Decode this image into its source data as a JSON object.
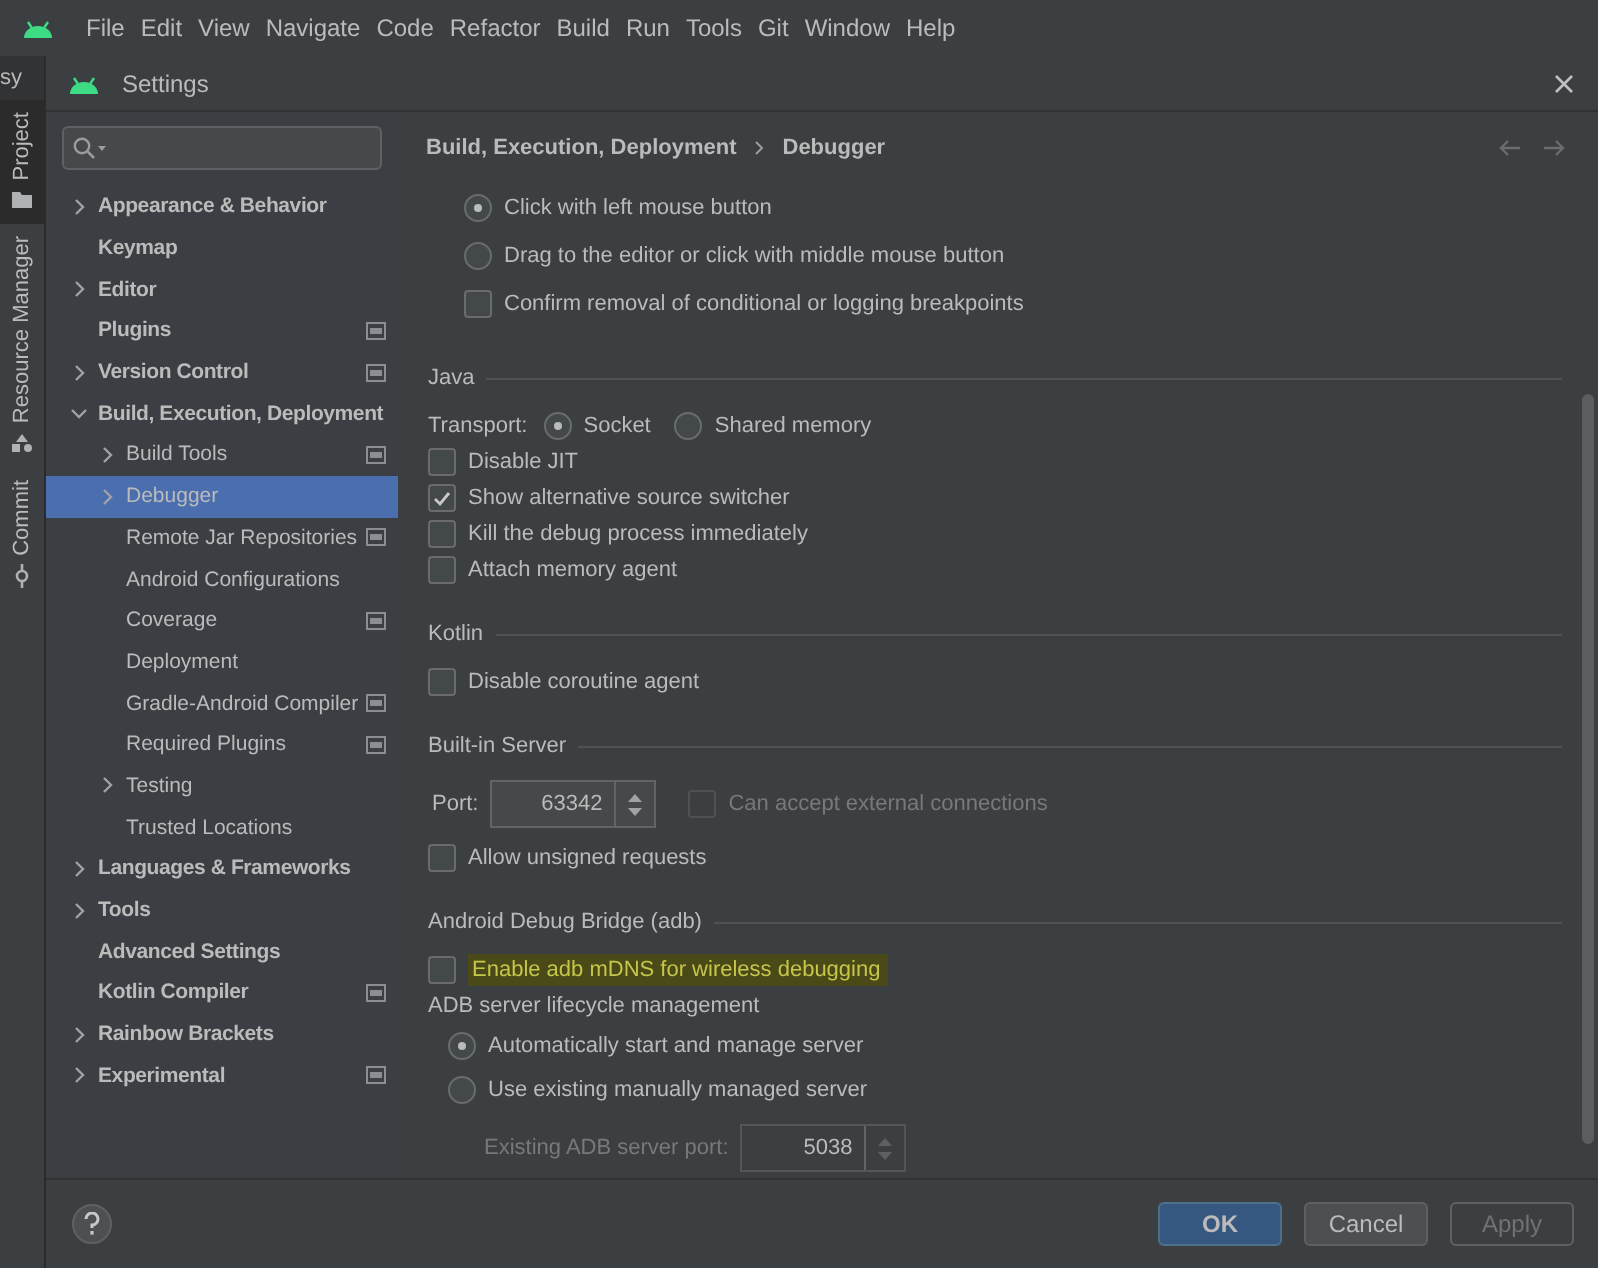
{
  "menubar": {
    "items": [
      "File",
      "Edit",
      "View",
      "Navigate",
      "Code",
      "Refactor",
      "Build",
      "Run",
      "Tools",
      "Git",
      "Window",
      "Help"
    ]
  },
  "ide_strip": {
    "project_name": "sy",
    "tabs": [
      {
        "label": "Project",
        "selected": true,
        "kind": "folder"
      },
      {
        "label": "Resource Manager",
        "selected": false,
        "kind": "shapes"
      },
      {
        "label": "Commit",
        "selected": false,
        "kind": "commit"
      }
    ]
  },
  "window": {
    "title": "Settings"
  },
  "sidebar": {
    "items": [
      {
        "label": "Appearance & Behavior",
        "kind": "branch",
        "expanded": false,
        "selected": false,
        "project_level": false
      },
      {
        "label": "Keymap",
        "kind": "leaf",
        "selected": false,
        "project_level": false
      },
      {
        "label": "Editor",
        "kind": "branch",
        "expanded": false,
        "selected": false,
        "project_level": false
      },
      {
        "label": "Plugins",
        "kind": "leaf",
        "selected": false,
        "project_level": true
      },
      {
        "label": "Version Control",
        "kind": "branch",
        "expanded": false,
        "selected": false,
        "project_level": true
      },
      {
        "label": "Build, Execution, Deployment",
        "kind": "branch",
        "expanded": true,
        "selected": false,
        "project_level": false,
        "children": [
          {
            "label": "Build Tools",
            "kind": "branch",
            "expanded": false,
            "selected": false,
            "project_level": true
          },
          {
            "label": "Debugger",
            "kind": "branch",
            "expanded": false,
            "selected": true,
            "project_level": false
          },
          {
            "label": "Remote Jar Repositories",
            "kind": "leaf",
            "selected": false,
            "project_level": true
          },
          {
            "label": "Android Configurations",
            "kind": "leaf",
            "selected": false,
            "project_level": false
          },
          {
            "label": "Coverage",
            "kind": "leaf",
            "selected": false,
            "project_level": true
          },
          {
            "label": "Deployment",
            "kind": "leaf",
            "selected": false,
            "project_level": false
          },
          {
            "label": "Gradle-Android Compiler",
            "kind": "leaf",
            "selected": false,
            "project_level": true
          },
          {
            "label": "Required Plugins",
            "kind": "leaf",
            "selected": false,
            "project_level": true
          },
          {
            "label": "Testing",
            "kind": "branch",
            "expanded": false,
            "selected": false,
            "project_level": false
          },
          {
            "label": "Trusted Locations",
            "kind": "leaf",
            "selected": false,
            "project_level": false
          }
        ]
      },
      {
        "label": "Languages & Frameworks",
        "kind": "branch",
        "expanded": false,
        "selected": false,
        "project_level": false
      },
      {
        "label": "Tools",
        "kind": "branch",
        "expanded": false,
        "selected": false,
        "project_level": false
      },
      {
        "label": "Advanced Settings",
        "kind": "leaf",
        "selected": false,
        "project_level": false
      },
      {
        "label": "Kotlin Compiler",
        "kind": "leaf",
        "selected": false,
        "project_level": true
      },
      {
        "label": "Rainbow Brackets",
        "kind": "branch",
        "expanded": false,
        "selected": false,
        "project_level": false
      },
      {
        "label": "Experimental",
        "kind": "branch",
        "expanded": false,
        "selected": false,
        "project_level": true
      }
    ]
  },
  "content": {
    "breadcrumb": [
      "Build, Execution, Deployment",
      "Debugger"
    ],
    "sections": [
      {
        "rows": [
          {
            "kind": "radio",
            "label": "Click with left mouse button",
            "selected": true
          },
          {
            "kind": "radio",
            "label": "Drag to the editor or click with middle mouse button",
            "selected": false
          },
          {
            "kind": "checkbox",
            "label": "Confirm removal of conditional or logging breakpoints",
            "checked": false
          }
        ]
      },
      {
        "title": "Java",
        "rows": [
          {
            "kind": "choice",
            "label": "Transport:",
            "options": [
              {
                "label": "Socket",
                "selected": true
              },
              {
                "label": "Shared memory",
                "selected": false
              }
            ]
          },
          {
            "kind": "checkbox",
            "label": "Disable JIT",
            "checked": false
          },
          {
            "kind": "checkbox",
            "label": "Show alternative source switcher",
            "checked": true
          },
          {
            "kind": "checkbox",
            "label": "Kill the debug process immediately",
            "checked": false
          },
          {
            "kind": "checkbox",
            "label": "Attach memory agent",
            "checked": false
          }
        ]
      },
      {
        "title": "Kotlin",
        "rows": [
          {
            "kind": "checkbox",
            "label": "Disable coroutine agent",
            "checked": false
          }
        ]
      },
      {
        "title": "Built-in Server",
        "rows": [
          {
            "kind": "port",
            "label": "Port:",
            "value": "63342",
            "disabled": false,
            "option": {
              "label": "Can accept external connections",
              "checked": false,
              "disabled": true
            }
          },
          {
            "kind": "checkbox",
            "label": "Allow unsigned requests",
            "checked": false
          }
        ]
      },
      {
        "title": "Android Debug Bridge (adb)",
        "rows": [
          {
            "kind": "checkbox",
            "label": "Enable adb mDNS for wireless debugging",
            "checked": false,
            "highlighted": true
          },
          {
            "kind": "group",
            "label": "ADB server lifecycle management",
            "children": [
              {
                "kind": "radio",
                "label": "Automatically start and manage server",
                "selected": true
              },
              {
                "kind": "radio",
                "label": "Use existing manually managed server",
                "selected": false
              },
              {
                "kind": "port",
                "label": "Existing ADB server port:",
                "value": "5038",
                "disabled": true
              }
            ]
          }
        ]
      }
    ]
  },
  "buttons": [
    {
      "label": "OK",
      "kind": "default"
    },
    {
      "label": "Cancel",
      "kind": "normal"
    },
    {
      "label": "Apply",
      "kind": "disabled"
    }
  ]
}
